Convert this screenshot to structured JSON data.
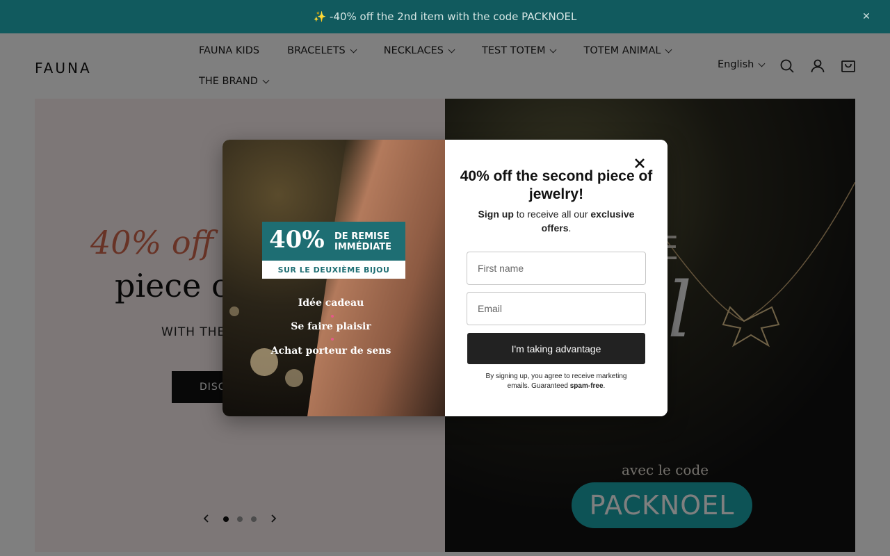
{
  "announcement": {
    "text": "✨ -40% off the 2nd item with the code PACKNOEL",
    "close_icon": "close-icon"
  },
  "header": {
    "logo": "FAUNA",
    "nav_row1": [
      "FAUNA KIDS",
      "BRACELETS",
      "NECKLACES",
      "TEST TOTEM",
      "TOTEM ANIMAL"
    ],
    "nav_row2": [
      "THE BRAND"
    ],
    "language": "English",
    "icons": [
      "search-icon",
      "account-icon",
      "cart-icon"
    ]
  },
  "hero": {
    "left": {
      "headline_1": "40% off t",
      "headline_2": "piece o",
      "subheadline": "WITH THE C",
      "button": "DISC"
    },
    "right": {
      "offre_text": "FFRE",
      "noel_text": "l",
      "avec_text": "avec le code",
      "code_text": "PACKNOEL"
    },
    "slider": {
      "prev_icon": "chevron-left-icon",
      "next_icon": "chevron-right-icon",
      "slides": 3,
      "active_index": 0
    }
  },
  "modal": {
    "image": {
      "promo_big": "40%",
      "promo_small_1": "DE REMISE",
      "promo_small_2": "IMMÉDIATE",
      "promo_strip": "SUR LE DEUXIÈME BIJOU",
      "line1": "Idée cadeau",
      "line2": "Se faire plaisir",
      "line3": "Achat porteur de sens"
    },
    "title": "40% off the second piece of jewelry!",
    "desc_bold1": "Sign up",
    "desc_mid": " to receive all our ",
    "desc_bold2": "exclusive offers",
    "desc_end": ".",
    "first_name_placeholder": "First name",
    "email_placeholder": "Email",
    "submit_label": "I'm taking advantage",
    "legal_text": "By signing up, you agree to receive marketing emails. Guaranteed ",
    "legal_bold": "spam-free",
    "legal_end": "."
  },
  "colors": {
    "announcement_bg": "#115a5e",
    "hero_left_bg": "#fbeeee",
    "headline_accent": "#d0674d",
    "button_dark": "#222222",
    "promo_teal": "#1e6e73",
    "code_pill": "#1aa6ac"
  }
}
